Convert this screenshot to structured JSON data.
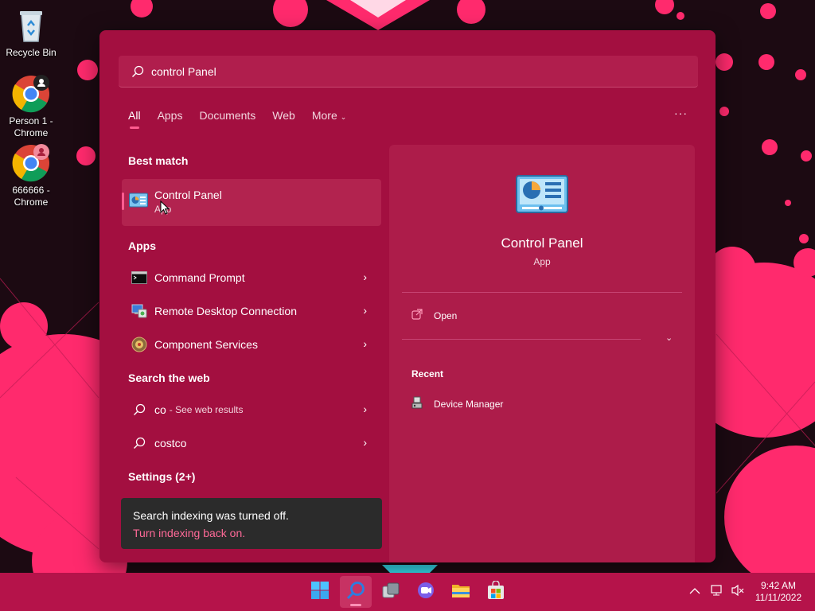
{
  "desktop": {
    "icons": [
      {
        "label": "Recycle Bin",
        "icon": "recycle-bin-icon"
      },
      {
        "label": "Person 1 - Chrome",
        "icon": "chrome-icon"
      },
      {
        "label": "666666 - Chrome",
        "icon": "chrome-icon"
      }
    ]
  },
  "search": {
    "query": "control Panel",
    "icon": "search-icon"
  },
  "tabs": [
    {
      "label": "All",
      "active": true
    },
    {
      "label": "Apps"
    },
    {
      "label": "Documents"
    },
    {
      "label": "Web"
    },
    {
      "label": "More",
      "icon": "chevron-down-icon"
    }
  ],
  "more_options_label": "···",
  "best_match": {
    "title": "Best match",
    "item": {
      "name": "Control Panel",
      "kind": "App",
      "icon": "control-panel-icon"
    }
  },
  "apps": {
    "title": "Apps",
    "items": [
      {
        "name": "Command Prompt",
        "icon": "command-prompt-icon"
      },
      {
        "name": "Remote Desktop Connection",
        "icon": "remote-desktop-icon"
      },
      {
        "name": "Component Services",
        "icon": "component-services-icon"
      }
    ]
  },
  "web": {
    "title": "Search the web",
    "items": [
      {
        "term": "co",
        "suffix": "- See web results",
        "icon": "search-icon"
      },
      {
        "term": "costco",
        "suffix": "",
        "icon": "search-icon"
      }
    ]
  },
  "settings": {
    "title": "Settings (2+)"
  },
  "toast": {
    "message": "Search indexing was turned off.",
    "link": "Turn indexing back on."
  },
  "preview": {
    "name": "Control Panel",
    "kind": "App",
    "open_label": "Open",
    "recent_title": "Recent",
    "recent_items": [
      {
        "name": "Device Manager",
        "icon": "device-manager-icon"
      }
    ]
  },
  "taskbar": {
    "items": [
      {
        "name": "start",
        "icon": "windows-logo-icon"
      },
      {
        "name": "search",
        "icon": "search-icon",
        "active": true
      },
      {
        "name": "task-view",
        "icon": "task-view-icon"
      },
      {
        "name": "teams-chat",
        "icon": "chat-icon"
      },
      {
        "name": "file-explorer",
        "icon": "folder-icon"
      },
      {
        "name": "microsoft-store",
        "icon": "store-icon"
      }
    ],
    "clock": {
      "time": "9:42 AM",
      "date": "11/11/2022"
    }
  },
  "colors": {
    "panel": "#a30f40",
    "accent": "#ff5c8f",
    "taskbar": "#b5134a",
    "wallpaper_pink": "#ff2a6d"
  }
}
